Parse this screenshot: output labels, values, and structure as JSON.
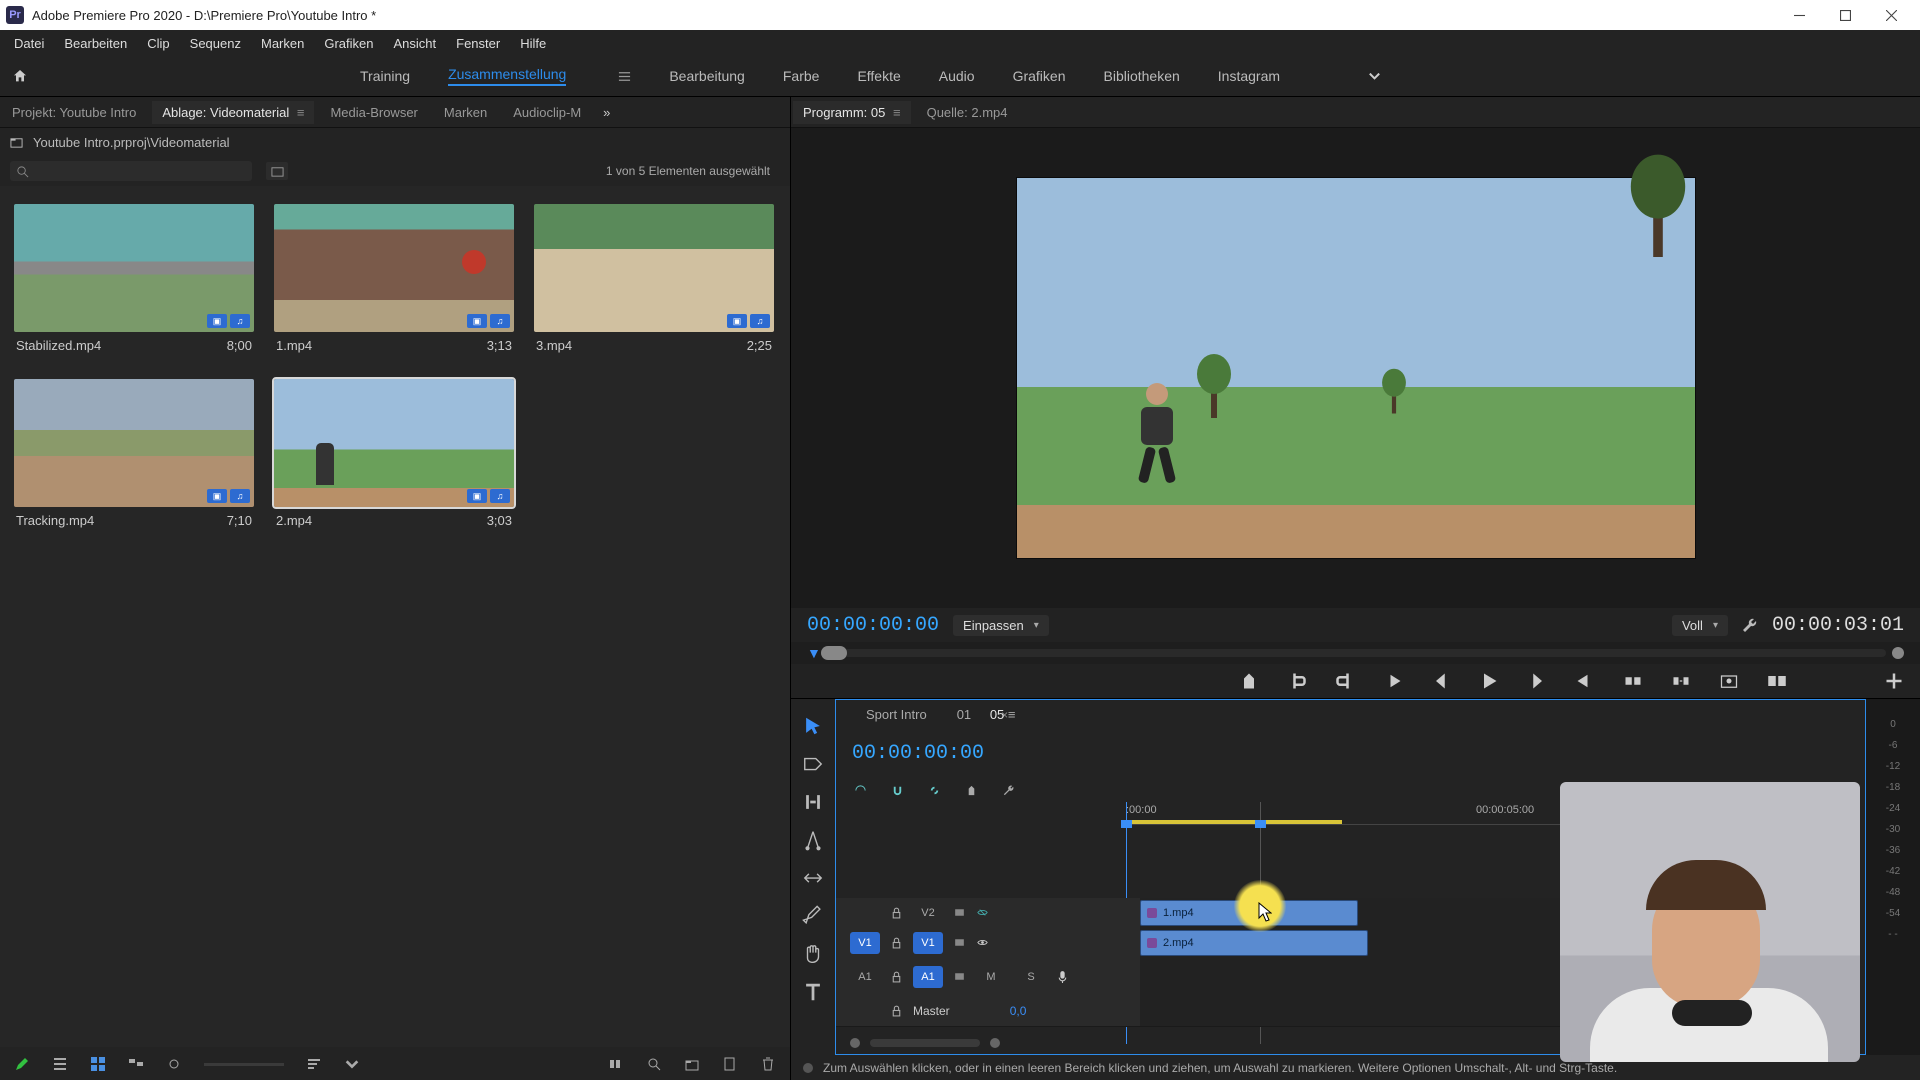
{
  "window": {
    "title": "Adobe Premiere Pro 2020 - D:\\Premiere Pro\\Youtube Intro *",
    "logo": "Pr"
  },
  "menu": [
    "Datei",
    "Bearbeiten",
    "Clip",
    "Sequenz",
    "Marken",
    "Grafiken",
    "Ansicht",
    "Fenster",
    "Hilfe"
  ],
  "workspaces": [
    "Training",
    "Zusammenstellung",
    "Bearbeitung",
    "Farbe",
    "Effekte",
    "Audio",
    "Grafiken",
    "Bibliotheken",
    "Instagram"
  ],
  "workspace_active_index": 1,
  "left_tabs": {
    "items": [
      "Projekt: Youtube Intro",
      "Ablage: Videomaterial",
      "Media-Browser",
      "Marken",
      "Audioclip-M"
    ],
    "active_index": 1
  },
  "right_tabs": {
    "items": [
      "Programm: 05",
      "Quelle: 2.mp4"
    ],
    "active_index": 0
  },
  "bin": {
    "path": "Youtube Intro.prproj\\Videomaterial",
    "status": "1 von 5 Elementen ausgewählt",
    "clips": [
      {
        "name": "Stabilized.mp4",
        "dur": "8;00",
        "thumb": "th-road",
        "selected": false
      },
      {
        "name": "1.mp4",
        "dur": "3;13",
        "thumb": "th-wall",
        "selected": false
      },
      {
        "name": "3.mp4",
        "dur": "2;25",
        "thumb": "th-sand",
        "selected": false
      },
      {
        "name": "Tracking.mp4",
        "dur": "7;10",
        "thumb": "th-dirt",
        "selected": false
      },
      {
        "name": "2.mp4",
        "dur": "3;03",
        "thumb": "th-field",
        "selected": true
      }
    ]
  },
  "program": {
    "timecode_left": "00:00:00:00",
    "fit_label": "Einpassen",
    "quality_label": "Voll",
    "timecode_right": "00:00:03:01"
  },
  "timeline": {
    "tabs": [
      {
        "label": "Sport Intro",
        "active": false
      },
      {
        "label": "01",
        "active": false
      },
      {
        "label": "05",
        "active": true
      }
    ],
    "timecode": "00:00:00:00",
    "ruler": [
      ":00:00",
      "00:00:05:00"
    ],
    "tracks": {
      "v2": {
        "label": "V2",
        "src": "",
        "clip": "1.mp4"
      },
      "v1": {
        "label": "V1",
        "src": "V1",
        "clip": "2.mp4"
      },
      "a1": {
        "label": "A1",
        "src": "A1",
        "m": "M",
        "s": "S"
      },
      "master": {
        "label": "Master",
        "val": "0,0"
      }
    }
  },
  "audiometer_ticks": [
    "0",
    "-6",
    "-12",
    "-18",
    "-24",
    "-30",
    "-36",
    "-42",
    "-48",
    "-54",
    "- -"
  ],
  "status": "Zum Auswählen klicken, oder in einen leeren Bereich klicken und ziehen, um Auswahl zu markieren. Weitere Optionen Umschalt-, Alt- und Strg-Taste."
}
